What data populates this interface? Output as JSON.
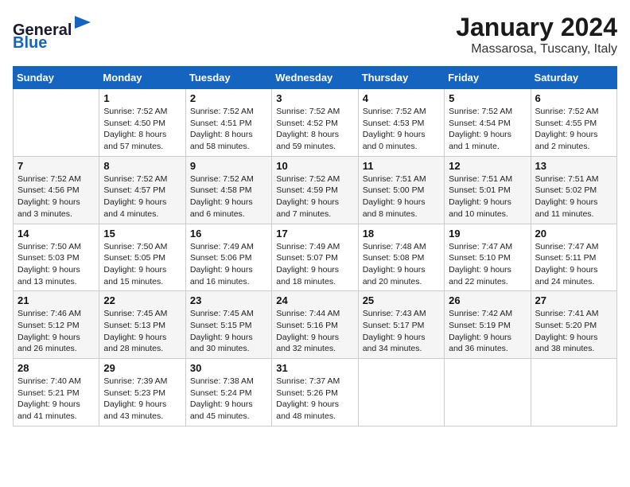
{
  "header": {
    "logo_line1": "General",
    "logo_line2": "Blue",
    "month": "January 2024",
    "location": "Massarosa, Tuscany, Italy"
  },
  "weekdays": [
    "Sunday",
    "Monday",
    "Tuesday",
    "Wednesday",
    "Thursday",
    "Friday",
    "Saturday"
  ],
  "weeks": [
    [
      {
        "day": "",
        "sunrise": "",
        "sunset": "",
        "daylight": ""
      },
      {
        "day": "1",
        "sunrise": "Sunrise: 7:52 AM",
        "sunset": "Sunset: 4:50 PM",
        "daylight": "Daylight: 8 hours and 57 minutes."
      },
      {
        "day": "2",
        "sunrise": "Sunrise: 7:52 AM",
        "sunset": "Sunset: 4:51 PM",
        "daylight": "Daylight: 8 hours and 58 minutes."
      },
      {
        "day": "3",
        "sunrise": "Sunrise: 7:52 AM",
        "sunset": "Sunset: 4:52 PM",
        "daylight": "Daylight: 8 hours and 59 minutes."
      },
      {
        "day": "4",
        "sunrise": "Sunrise: 7:52 AM",
        "sunset": "Sunset: 4:53 PM",
        "daylight": "Daylight: 9 hours and 0 minutes."
      },
      {
        "day": "5",
        "sunrise": "Sunrise: 7:52 AM",
        "sunset": "Sunset: 4:54 PM",
        "daylight": "Daylight: 9 hours and 1 minute."
      },
      {
        "day": "6",
        "sunrise": "Sunrise: 7:52 AM",
        "sunset": "Sunset: 4:55 PM",
        "daylight": "Daylight: 9 hours and 2 minutes."
      }
    ],
    [
      {
        "day": "7",
        "sunrise": "Sunrise: 7:52 AM",
        "sunset": "Sunset: 4:56 PM",
        "daylight": "Daylight: 9 hours and 3 minutes."
      },
      {
        "day": "8",
        "sunrise": "Sunrise: 7:52 AM",
        "sunset": "Sunset: 4:57 PM",
        "daylight": "Daylight: 9 hours and 4 minutes."
      },
      {
        "day": "9",
        "sunrise": "Sunrise: 7:52 AM",
        "sunset": "Sunset: 4:58 PM",
        "daylight": "Daylight: 9 hours and 6 minutes."
      },
      {
        "day": "10",
        "sunrise": "Sunrise: 7:52 AM",
        "sunset": "Sunset: 4:59 PM",
        "daylight": "Daylight: 9 hours and 7 minutes."
      },
      {
        "day": "11",
        "sunrise": "Sunrise: 7:51 AM",
        "sunset": "Sunset: 5:00 PM",
        "daylight": "Daylight: 9 hours and 8 minutes."
      },
      {
        "day": "12",
        "sunrise": "Sunrise: 7:51 AM",
        "sunset": "Sunset: 5:01 PM",
        "daylight": "Daylight: 9 hours and 10 minutes."
      },
      {
        "day": "13",
        "sunrise": "Sunrise: 7:51 AM",
        "sunset": "Sunset: 5:02 PM",
        "daylight": "Daylight: 9 hours and 11 minutes."
      }
    ],
    [
      {
        "day": "14",
        "sunrise": "Sunrise: 7:50 AM",
        "sunset": "Sunset: 5:03 PM",
        "daylight": "Daylight: 9 hours and 13 minutes."
      },
      {
        "day": "15",
        "sunrise": "Sunrise: 7:50 AM",
        "sunset": "Sunset: 5:05 PM",
        "daylight": "Daylight: 9 hours and 15 minutes."
      },
      {
        "day": "16",
        "sunrise": "Sunrise: 7:49 AM",
        "sunset": "Sunset: 5:06 PM",
        "daylight": "Daylight: 9 hours and 16 minutes."
      },
      {
        "day": "17",
        "sunrise": "Sunrise: 7:49 AM",
        "sunset": "Sunset: 5:07 PM",
        "daylight": "Daylight: 9 hours and 18 minutes."
      },
      {
        "day": "18",
        "sunrise": "Sunrise: 7:48 AM",
        "sunset": "Sunset: 5:08 PM",
        "daylight": "Daylight: 9 hours and 20 minutes."
      },
      {
        "day": "19",
        "sunrise": "Sunrise: 7:47 AM",
        "sunset": "Sunset: 5:10 PM",
        "daylight": "Daylight: 9 hours and 22 minutes."
      },
      {
        "day": "20",
        "sunrise": "Sunrise: 7:47 AM",
        "sunset": "Sunset: 5:11 PM",
        "daylight": "Daylight: 9 hours and 24 minutes."
      }
    ],
    [
      {
        "day": "21",
        "sunrise": "Sunrise: 7:46 AM",
        "sunset": "Sunset: 5:12 PM",
        "daylight": "Daylight: 9 hours and 26 minutes."
      },
      {
        "day": "22",
        "sunrise": "Sunrise: 7:45 AM",
        "sunset": "Sunset: 5:13 PM",
        "daylight": "Daylight: 9 hours and 28 minutes."
      },
      {
        "day": "23",
        "sunrise": "Sunrise: 7:45 AM",
        "sunset": "Sunset: 5:15 PM",
        "daylight": "Daylight: 9 hours and 30 minutes."
      },
      {
        "day": "24",
        "sunrise": "Sunrise: 7:44 AM",
        "sunset": "Sunset: 5:16 PM",
        "daylight": "Daylight: 9 hours and 32 minutes."
      },
      {
        "day": "25",
        "sunrise": "Sunrise: 7:43 AM",
        "sunset": "Sunset: 5:17 PM",
        "daylight": "Daylight: 9 hours and 34 minutes."
      },
      {
        "day": "26",
        "sunrise": "Sunrise: 7:42 AM",
        "sunset": "Sunset: 5:19 PM",
        "daylight": "Daylight: 9 hours and 36 minutes."
      },
      {
        "day": "27",
        "sunrise": "Sunrise: 7:41 AM",
        "sunset": "Sunset: 5:20 PM",
        "daylight": "Daylight: 9 hours and 38 minutes."
      }
    ],
    [
      {
        "day": "28",
        "sunrise": "Sunrise: 7:40 AM",
        "sunset": "Sunset: 5:21 PM",
        "daylight": "Daylight: 9 hours and 41 minutes."
      },
      {
        "day": "29",
        "sunrise": "Sunrise: 7:39 AM",
        "sunset": "Sunset: 5:23 PM",
        "daylight": "Daylight: 9 hours and 43 minutes."
      },
      {
        "day": "30",
        "sunrise": "Sunrise: 7:38 AM",
        "sunset": "Sunset: 5:24 PM",
        "daylight": "Daylight: 9 hours and 45 minutes."
      },
      {
        "day": "31",
        "sunrise": "Sunrise: 7:37 AM",
        "sunset": "Sunset: 5:26 PM",
        "daylight": "Daylight: 9 hours and 48 minutes."
      },
      {
        "day": "",
        "sunrise": "",
        "sunset": "",
        "daylight": ""
      },
      {
        "day": "",
        "sunrise": "",
        "sunset": "",
        "daylight": ""
      },
      {
        "day": "",
        "sunrise": "",
        "sunset": "",
        "daylight": ""
      }
    ]
  ]
}
